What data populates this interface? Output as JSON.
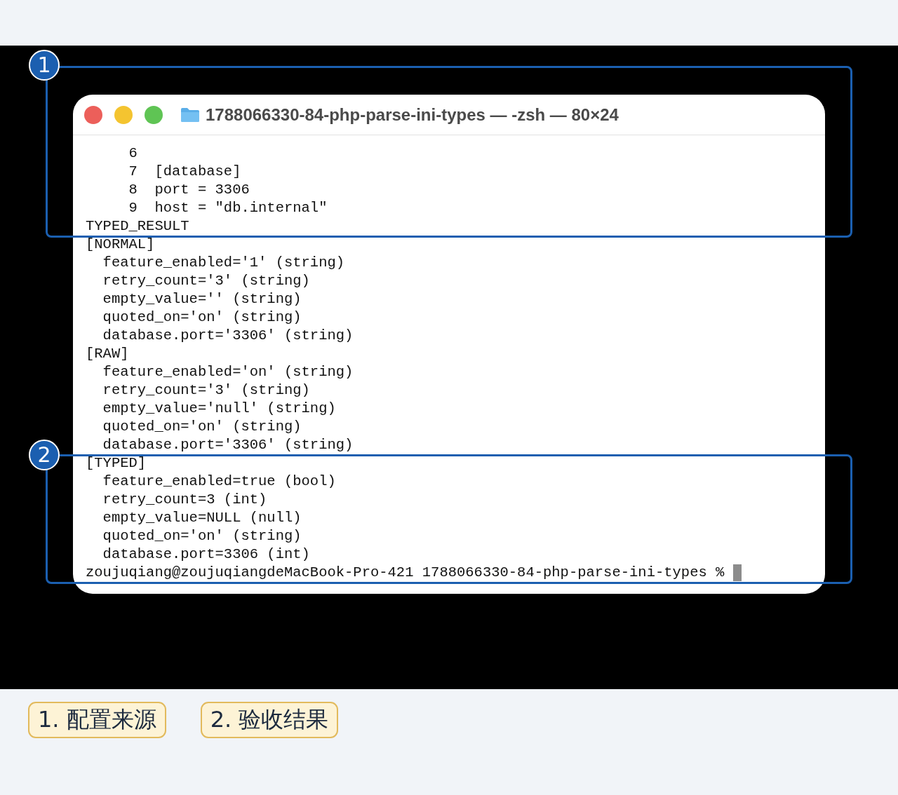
{
  "window": {
    "title": "1788066330-84-php-parse-ini-types — -zsh — 80×24"
  },
  "terminal": {
    "lines": [
      "     6",
      "     7  [database]",
      "     8  port = 3306",
      "     9  host = \"db.internal\"",
      "TYPED_RESULT",
      "[NORMAL]",
      "  feature_enabled='1' (string)",
      "  retry_count='3' (string)",
      "  empty_value='' (string)",
      "  quoted_on='on' (string)",
      "  database.port='3306' (string)",
      "[RAW]",
      "  feature_enabled='on' (string)",
      "  retry_count='3' (string)",
      "  empty_value='null' (string)",
      "  quoted_on='on' (string)",
      "  database.port='3306' (string)",
      "[TYPED]",
      "  feature_enabled=true (bool)",
      "  retry_count=3 (int)",
      "  empty_value=NULL (null)",
      "  quoted_on='on' (string)",
      "  database.port=3306 (int)"
    ],
    "prompt": "zoujuqiang@zoujuqiangdeMacBook-Pro-421 1788066330-84-php-parse-ini-types % "
  },
  "annotations": [
    {
      "label": "1"
    },
    {
      "label": "2"
    }
  ],
  "steps": [
    {
      "label": "1. 配置来源"
    },
    {
      "label": "2. 验收结果"
    }
  ]
}
